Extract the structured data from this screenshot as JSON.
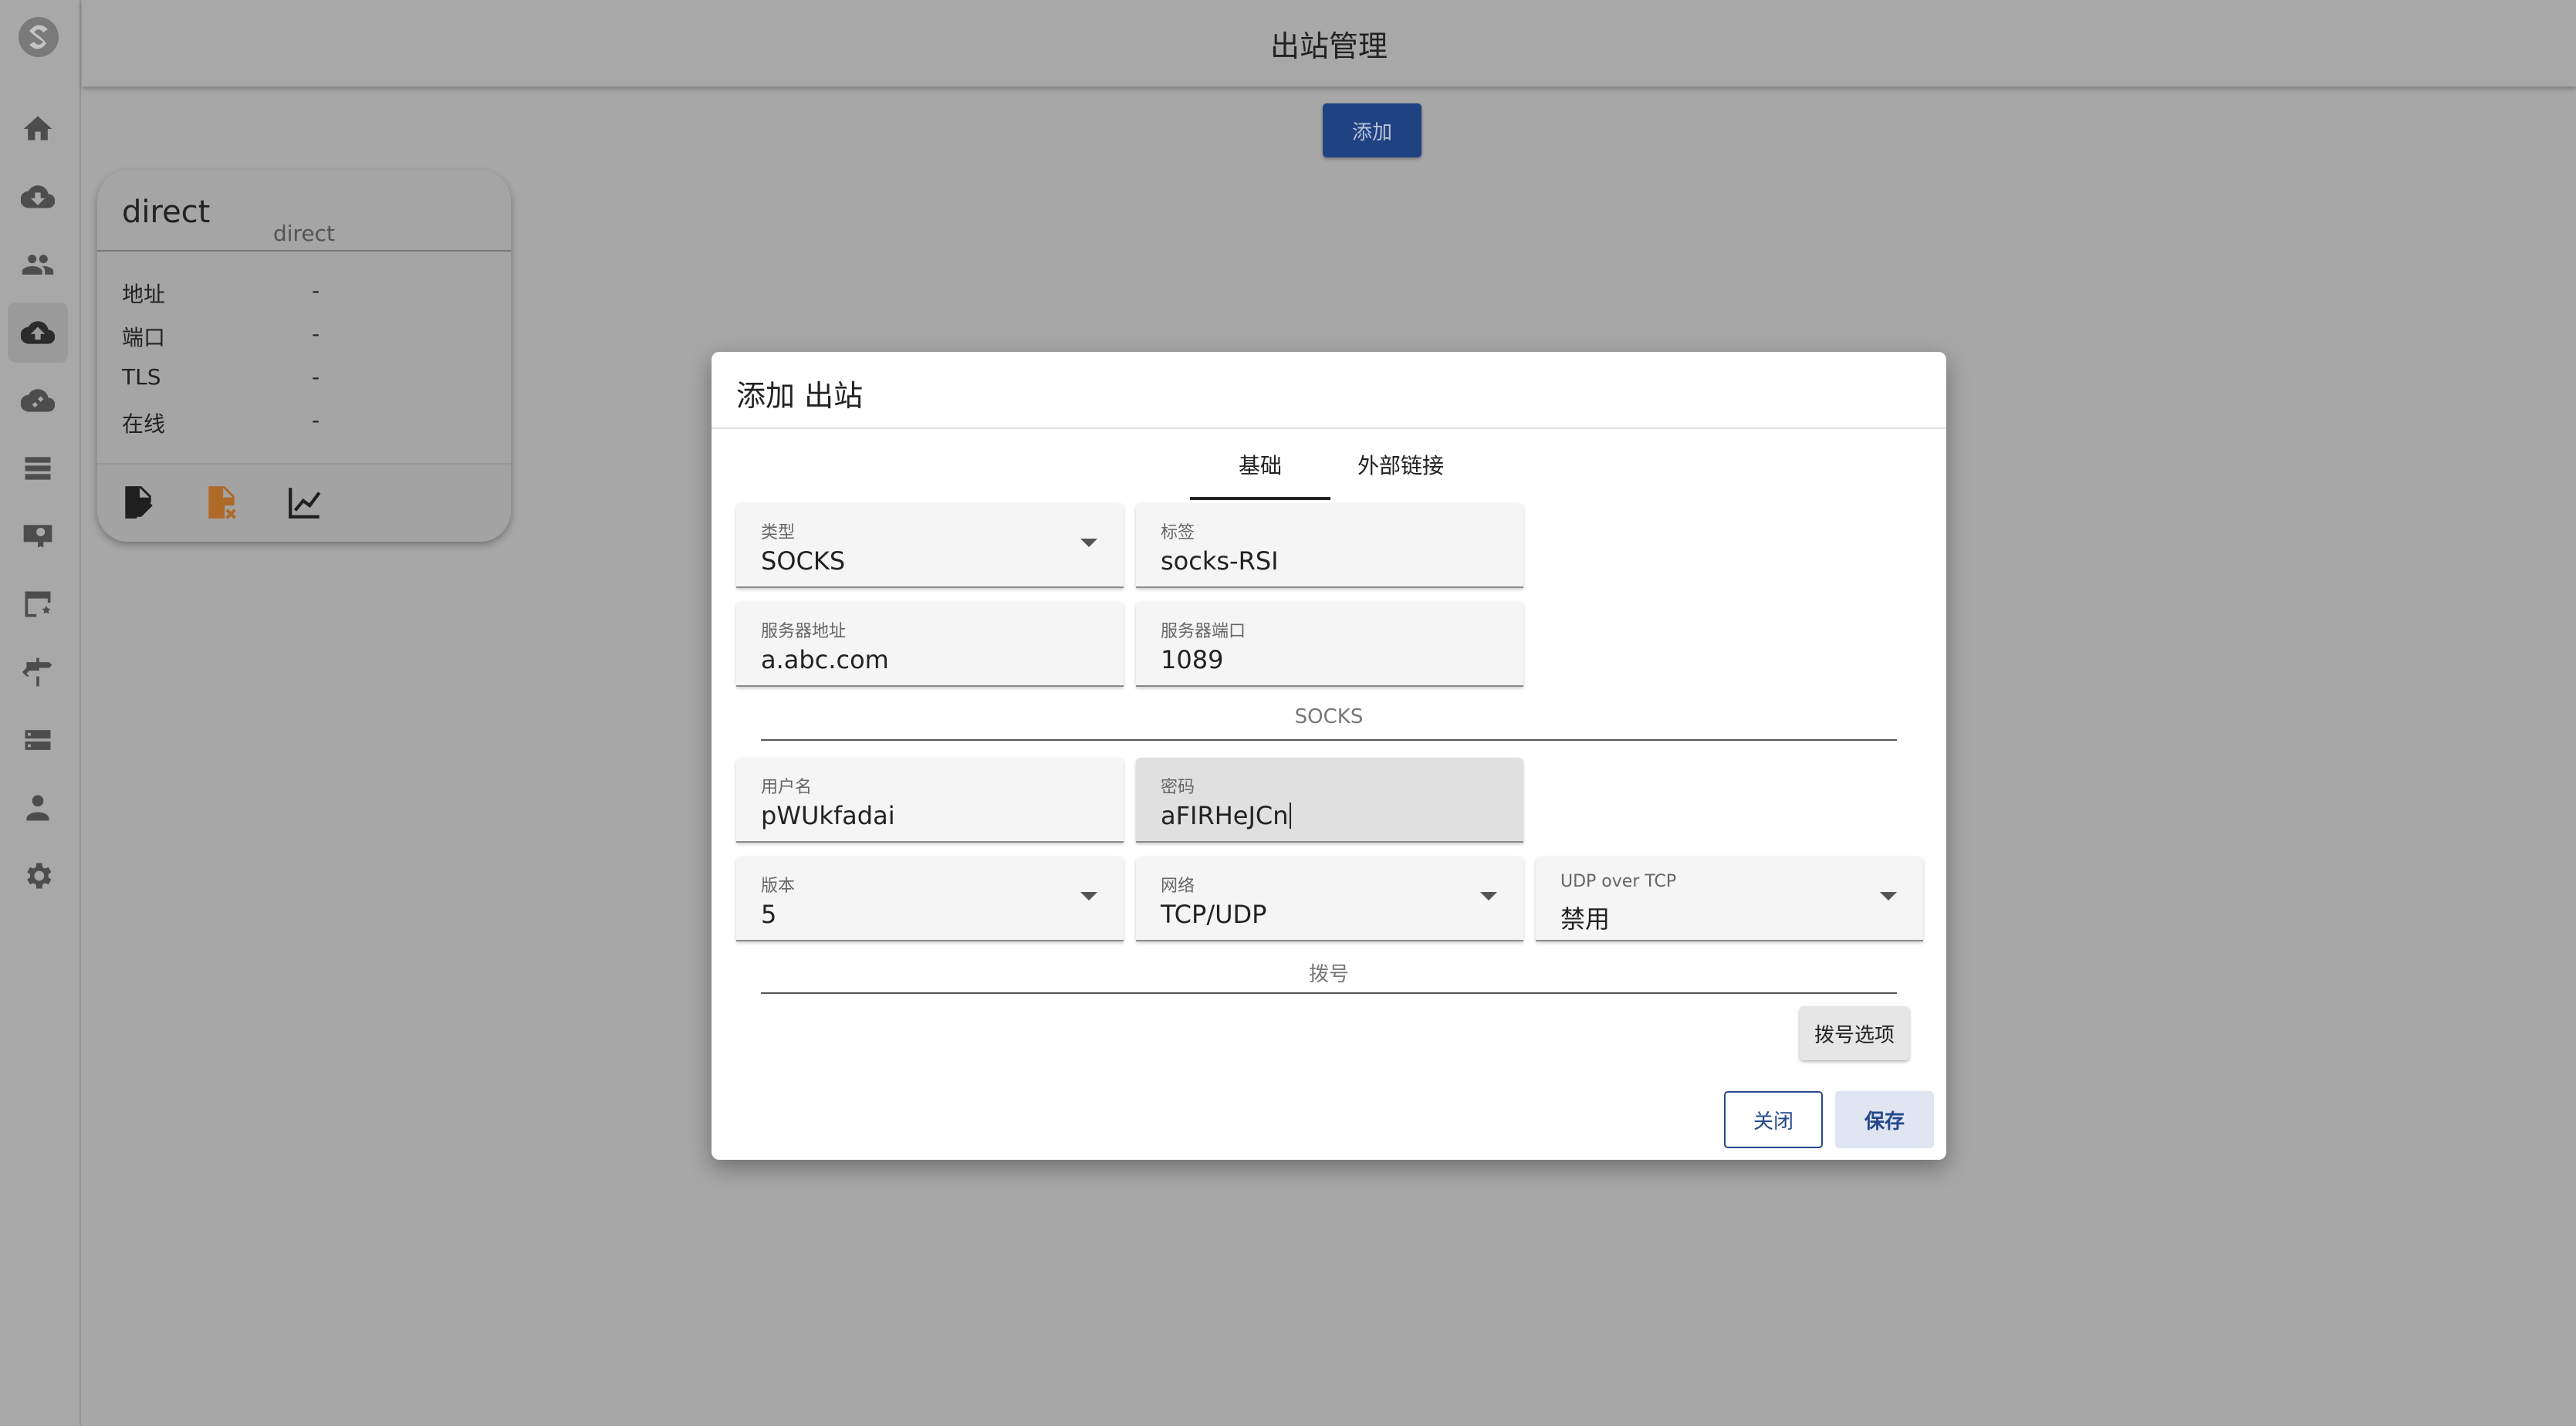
{
  "topbar": {
    "title": "出站管理"
  },
  "toolbar": {
    "add_label": "添加"
  },
  "sidebar": {
    "logo": "app-logo",
    "items": [
      {
        "icon": "home-icon",
        "active": false
      },
      {
        "icon": "inbound-cloud-download-icon",
        "active": false
      },
      {
        "icon": "users-icon",
        "active": false
      },
      {
        "icon": "outbound-cloud-upload-icon",
        "active": true
      },
      {
        "icon": "cloud-sync-icon",
        "active": false
      },
      {
        "icon": "server-list-icon",
        "active": false
      },
      {
        "icon": "certificate-icon",
        "active": false
      },
      {
        "icon": "dns-settings-icon",
        "active": false
      },
      {
        "icon": "routing-signpost-icon",
        "active": false
      },
      {
        "icon": "storage-icon",
        "active": false
      },
      {
        "icon": "admin-user-icon",
        "active": false
      },
      {
        "icon": "gear-icon",
        "active": false
      }
    ]
  },
  "card": {
    "title": "direct",
    "subtitle": "direct",
    "rows": [
      {
        "label": "地址",
        "value": "-"
      },
      {
        "label": "端口",
        "value": "-"
      },
      {
        "label": "TLS",
        "value": "-"
      },
      {
        "label": "在线",
        "value": "-"
      }
    ],
    "actions": [
      "edit-icon",
      "delete-file-icon",
      "stats-chart-icon"
    ]
  },
  "modal": {
    "title": "添加 出站",
    "tabs": [
      {
        "label": "基础",
        "active": true
      },
      {
        "label": "外部链接",
        "active": false
      }
    ],
    "fields": {
      "type": {
        "label": "类型",
        "value": "SOCKS"
      },
      "tag": {
        "label": "标签",
        "value": "socks-RSI"
      },
      "server": {
        "label": "服务器地址",
        "value": "a.abc.com"
      },
      "port": {
        "label": "服务器端口",
        "value": "1089"
      },
      "username": {
        "label": "用户名",
        "value": "pWUkfadai"
      },
      "password": {
        "label": "密码",
        "value": "aFIRHeJCn"
      },
      "version": {
        "label": "版本",
        "value": "5"
      },
      "network": {
        "label": "网络",
        "value": "TCP/UDP"
      },
      "udp_over_tcp": {
        "label": "UDP over TCP",
        "value": "禁用"
      }
    },
    "sections": {
      "protocol": "SOCKS",
      "dial": "拨号"
    },
    "dial_options_label": "拨号选项",
    "close_label": "关闭",
    "save_label": "保存"
  },
  "colors": {
    "primary": "#1f4283",
    "overlay": "#a7a7a7",
    "warning_icon": "#b06a28"
  }
}
